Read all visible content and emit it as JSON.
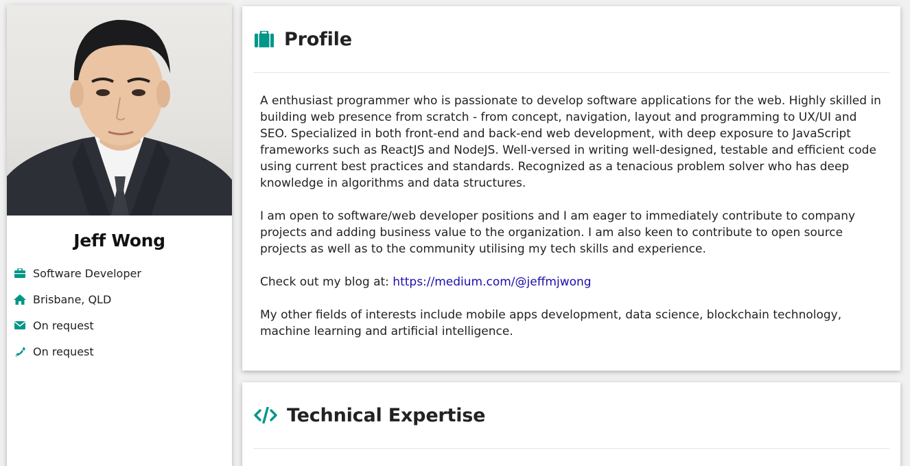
{
  "profile_card": {
    "name": "Jeff Wong",
    "details": [
      {
        "icon": "briefcase-icon",
        "text": "Software Developer"
      },
      {
        "icon": "home-icon",
        "text": "Brisbane, QLD"
      },
      {
        "icon": "envelope-icon",
        "text": "On request"
      },
      {
        "icon": "phone-icon",
        "text": "On request"
      }
    ]
  },
  "profile_section": {
    "icon": "suitcase-icon",
    "title": "Profile",
    "paragraph_1": "A enthusiast programmer who is passionate to develop software applications for the web. Highly skilled in building web presence from scratch - from concept, navigation, layout and programming to UX/UI and SEO. Specialized in both front-end and back-end web development, with deep exposure to JavaScript frameworks such as ReactJS and NodeJS. Well-versed in writing well-designed, testable and efficient code using current best practices and standards. Recognized as a tenacious problem solver who has deep knowledge in algorithms and data structures.",
    "paragraph_2": "I am open to software/web developer positions and I am eager to immediately contribute to company projects and adding business value to the organization. I am also keen to contribute to open source projects as well as to the community utilising my tech skills and experience.",
    "blog_prefix": "Check out my blog at: ",
    "blog_link": "https://medium.com/@jeffmjwong",
    "paragraph_4": "My other fields of interests include mobile apps development, data science, blockchain technology, machine learning and artificial intelligence."
  },
  "tech_section": {
    "icon": "code-icon",
    "title": "Technical Expertise"
  },
  "colors": {
    "accent": "#009688",
    "link": "#1a0dab"
  }
}
